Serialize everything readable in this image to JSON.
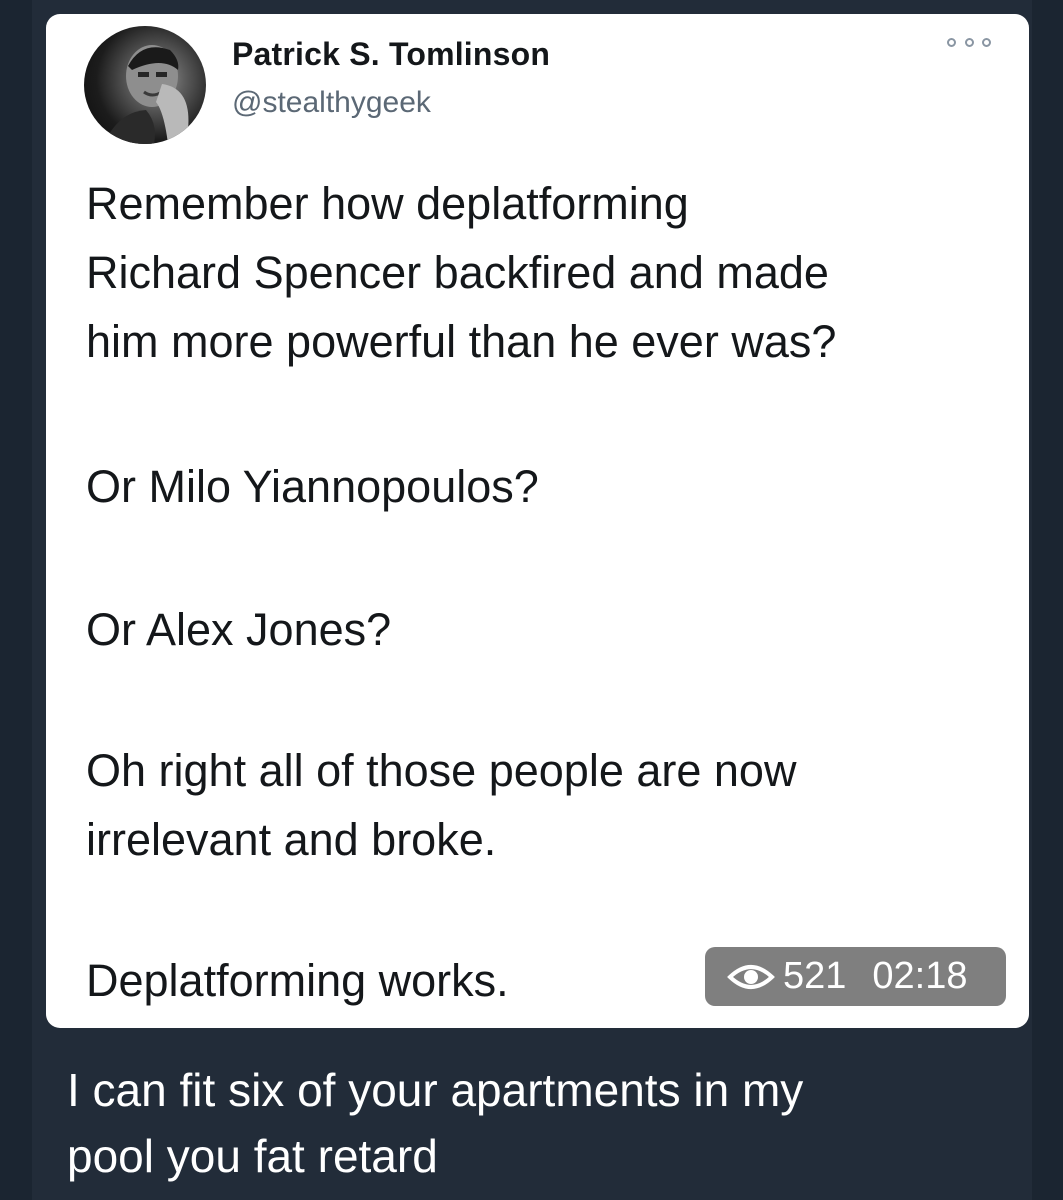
{
  "tweet": {
    "author_name": "Patrick S. Tomlinson",
    "author_handle": "@stealthygeek",
    "lines": [
      "Remember how deplatforming",
      "Richard Spencer backfired and made",
      "him more powerful than he ever was?",
      "Or Milo Yiannopoulos?",
      "Or Alex Jones?",
      "Oh right all of those people are now",
      "irrelevant and broke.",
      "Deplatforming works."
    ]
  },
  "message_meta": {
    "view_icon": "eye-icon",
    "views": "521",
    "time": "02:18"
  },
  "caption": {
    "lines": [
      "I can fit six of your apartments in my",
      "pool you fat retard"
    ]
  },
  "icons": {
    "more": "more-options-icon",
    "avatar": "author-avatar"
  },
  "colors": {
    "background": "#1b2531",
    "bubble": "#222c39",
    "card": "#ffffff",
    "badge": "#7f7f7f"
  }
}
